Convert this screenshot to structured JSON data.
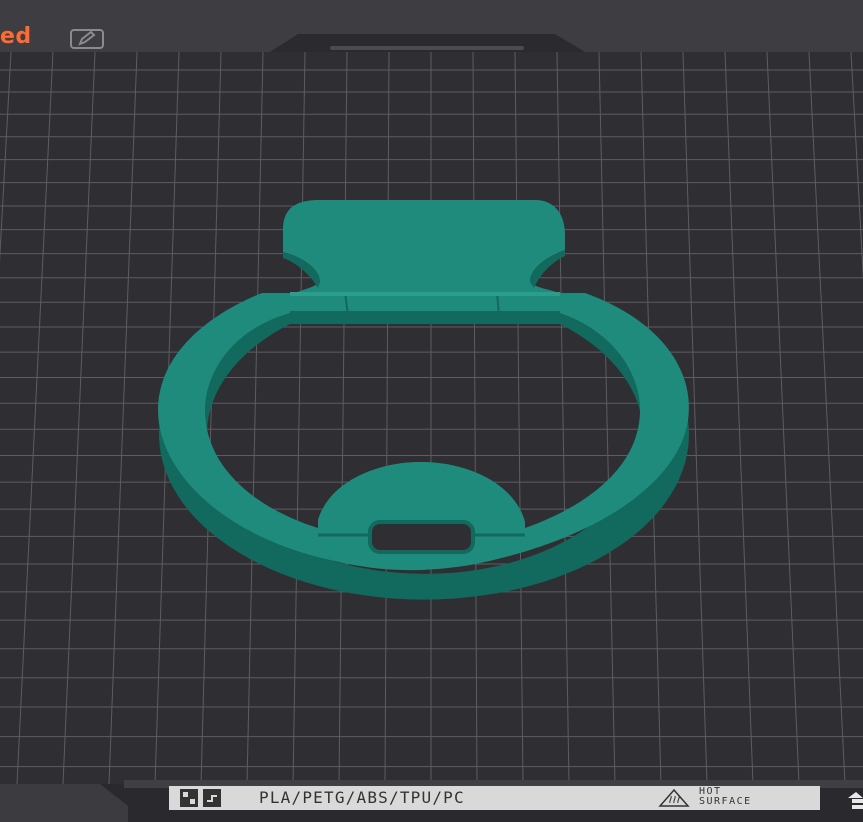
{
  "header": {
    "file_title_fragment": "ed",
    "edit_icon": "edit-icon"
  },
  "build_plate": {
    "label": {
      "materials": "PLA/PETG/ABS/TPU/PC",
      "warning_line1": "HOT",
      "warning_line2": "SURFACE",
      "warning_icon": "hot-surface-icon",
      "left_icons": [
        "plate-logo-icon",
        "plate-logo-icon-2"
      ]
    },
    "corner_icon": "upload-icon"
  },
  "model": {
    "name": "ring-holder-part",
    "color": "#1f8b7c",
    "edge_color": "#12695d"
  },
  "colors": {
    "background": "#3b3b40",
    "plate": "#2f2f33",
    "grid": "#5a5a60",
    "accent": "#ff6a33"
  }
}
